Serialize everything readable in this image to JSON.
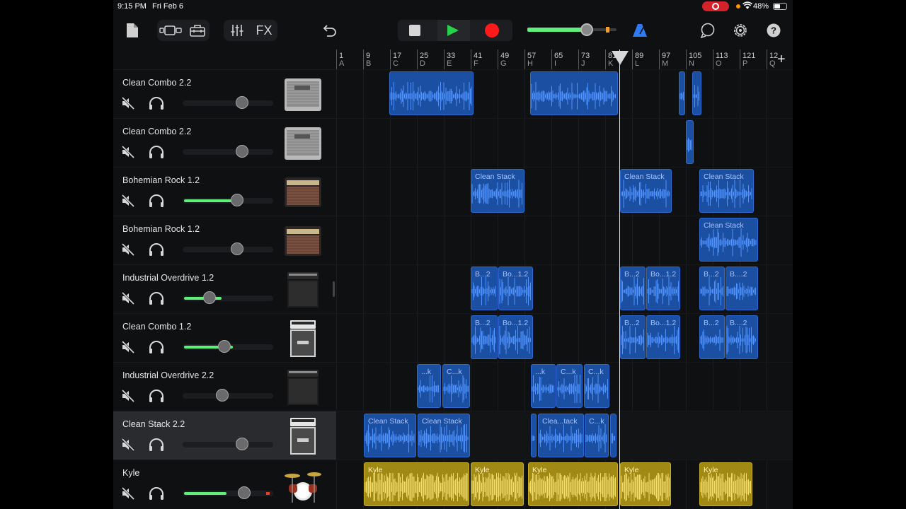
{
  "status_bar": {
    "time": "9:15 PM",
    "date": "Fri Feb 6",
    "battery": "48%"
  },
  "toolbar": {
    "fx_label": "FX",
    "master_volume_level": 0.67,
    "accent_green": "#29d04b",
    "record_red": "#ff1a1a"
  },
  "ruler": {
    "bars": [
      "1",
      "9",
      "17",
      "25",
      "33",
      "41",
      "49",
      "57",
      "65",
      "73",
      "81",
      "89",
      "97",
      "105",
      "113",
      "121",
      "12"
    ],
    "sections": [
      "A",
      "B",
      "C",
      "D",
      "E",
      "F",
      "G",
      "H",
      "I",
      "J",
      "K",
      "L",
      "M",
      "N",
      "O",
      "P",
      "Q"
    ]
  },
  "tracks": [
    {
      "name": "Clean Combo 2.2",
      "volume": 0.66,
      "level": 0.0,
      "instrument": "combo-amp-icon"
    },
    {
      "name": "Clean Combo 2.2",
      "volume": 0.66,
      "level": 0.0,
      "instrument": "combo-amp-icon"
    },
    {
      "name": "Bohemian Rock 1.2",
      "volume": 0.6,
      "level": 0.62,
      "instrument": "vintage-amp-icon"
    },
    {
      "name": "Bohemian Rock 1.2",
      "volume": 0.6,
      "level": 0.0,
      "instrument": "vintage-amp-icon"
    },
    {
      "name": "Industrial Overdrive 1.2",
      "volume": 0.3,
      "level": 0.43,
      "instrument": "stack-amp-icon"
    },
    {
      "name": "Clean Combo 1.2",
      "volume": 0.46,
      "level": 0.56,
      "instrument": "half-stack-amp-icon"
    },
    {
      "name": "Industrial Overdrive 2.2",
      "volume": 0.44,
      "level": 0.0,
      "instrument": "stack-amp-icon"
    },
    {
      "name": "Clean Stack 2.2",
      "volume": 0.66,
      "level": 0.0,
      "instrument": "half-stack-amp-icon"
    },
    {
      "name": "Kyle",
      "volume": 0.68,
      "level": 0.48,
      "instrument": "drum-kit-icon"
    }
  ],
  "regions": {
    "r3a": "Clean Stack",
    "r3b": "Clean Stack",
    "r3c": "Clean Stack",
    "r4a": "Clean Stack",
    "r5a": "B...2",
    "r5b": "Bo...1.2",
    "r5c": "B...2",
    "r5d": "Bo...1.2",
    "r5e": "B...2",
    "r5f": "B....2",
    "r6a": "B...2",
    "r6b": "Bo...1.2",
    "r6c": "B...2",
    "r6d": "Bo...1.2",
    "r6e": "B...2",
    "r6f": "B....2",
    "r7a": "...k",
    "r7b": "C...k",
    "r7c": "...k",
    "r7d": "C...k",
    "r7e": "C...k",
    "r8a": "Clean Stack",
    "r8b": "Clean Stack",
    "r8c": "Clea...tack",
    "r8d": "C...k",
    "r9a": "Kyle",
    "r9b": "Kyle",
    "r9c": "Kyle",
    "r9d": "Kyle",
    "r9e": "Kyle"
  }
}
